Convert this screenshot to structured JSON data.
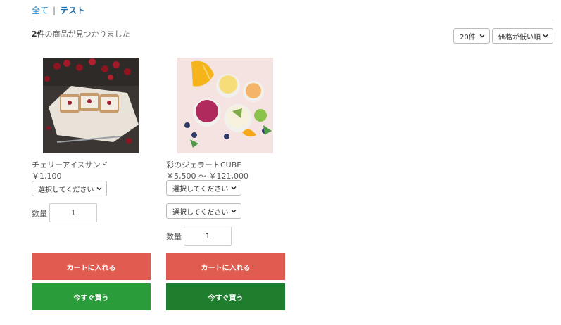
{
  "breadcrumb": {
    "all": "全て",
    "separator": "|",
    "current": "テスト"
  },
  "result": {
    "count": "2件",
    "suffix": "の商品が見つかりました"
  },
  "controls": {
    "per_page": "20件",
    "sort": "価格が低い順"
  },
  "products": [
    {
      "name": "チェリーアイスサンド",
      "price": "￥1,100",
      "selects": [
        "選択してください"
      ],
      "qty_label": "数量",
      "qty": "1",
      "cart_label": "カートに入れる",
      "buy_label": "今すぐ買う"
    },
    {
      "name": "彩のジェラートCUBE",
      "price": "￥5,500 ～ ￥121,000",
      "selects": [
        "選択してください",
        "選択してください"
      ],
      "qty_label": "数量",
      "qty": "1",
      "cart_label": "カートに入れる",
      "buy_label": "今すぐ買う"
    }
  ],
  "colors": {
    "cart": "#e05c50",
    "buy_1": "#2a9d3a",
    "buy_2": "#1e7e2e",
    "link": "#2c8fd1"
  },
  "icons": {
    "select_caret": "chevron-down-icon"
  }
}
